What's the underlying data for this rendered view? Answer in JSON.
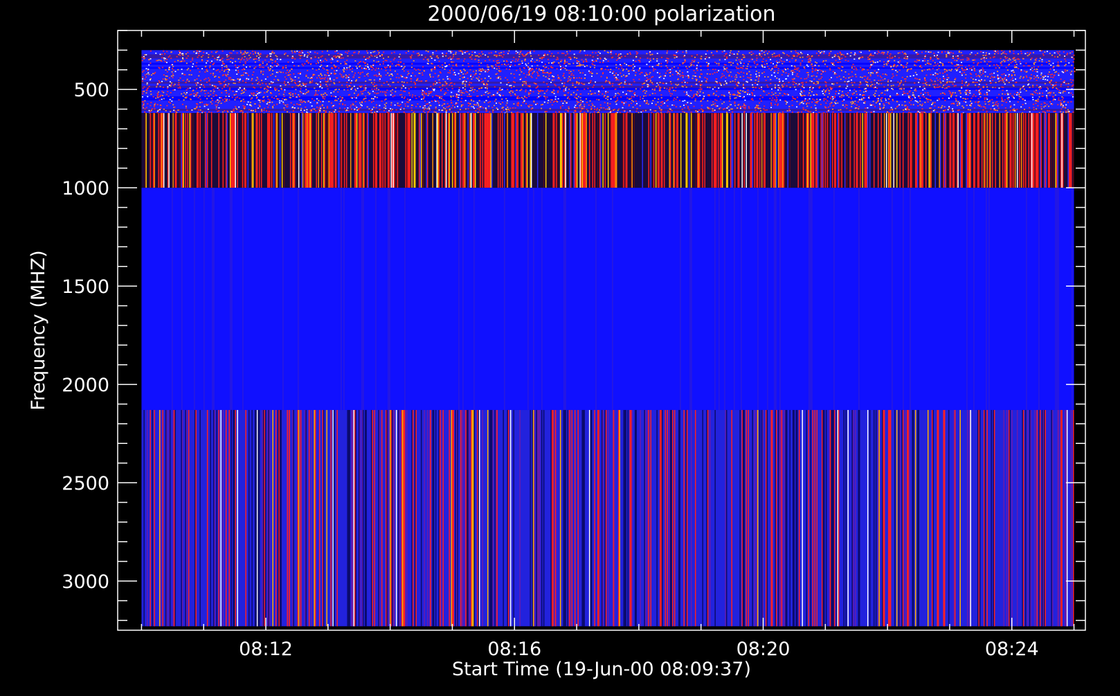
{
  "chart_data": {
    "type": "heatmap",
    "title": "2000/06/19 08:10:00 polarization",
    "xlabel": "Start Time (19-Jun-00 08:09:37)",
    "ylabel": "Frequency (MHZ)",
    "x_axis": {
      "unit": "time",
      "range": [
        "08:09:37",
        "08:25:11"
      ],
      "data_range": [
        "08:10:00",
        "08:25:00"
      ],
      "tick_labels": [
        "08:12",
        "08:16",
        "08:20",
        "08:24"
      ],
      "tick_values": [
        "08:12:00",
        "08:16:00",
        "08:20:00",
        "08:24:00"
      ],
      "minor_tick_interval_min": 1
    },
    "y_axis": {
      "unit": "MHz",
      "range": [
        200,
        3250
      ],
      "reversed": true,
      "data_range": [
        300,
        3230
      ],
      "tick_labels": [
        "500",
        "1000",
        "1500",
        "2000",
        "2500",
        "3000"
      ],
      "tick_values": [
        500,
        1000,
        1500,
        2000,
        2500,
        3000
      ],
      "minor_tick_interval": 100
    },
    "bands": [
      {
        "freq_range": [
          300,
          620
        ],
        "pattern": "noisy horizontal speckle",
        "dominant": "#2020ff",
        "accents": [
          "#ff2a2a",
          "#ff9a2a",
          "#ffffff"
        ]
      },
      {
        "freq_range": [
          620,
          1000
        ],
        "pattern": "vertical striations",
        "dominant": "#1a0b3a",
        "accents": [
          "#ff2020",
          "#ffcc00",
          "#ff8c00",
          "#ffffff",
          "#2a2aff"
        ]
      },
      {
        "freq_range": [
          1000,
          2130
        ],
        "pattern": "mostly uniform",
        "dominant": "#1010ff",
        "accents": [
          "#5a2aa0"
        ]
      },
      {
        "freq_range": [
          2130,
          3230
        ],
        "pattern": "vertical striations",
        "dominant": "#2222dd",
        "accents": [
          "#ff2020",
          "#ffb000",
          "#ffffff",
          "#0a0a6a"
        ]
      }
    ],
    "colors": {
      "background": "#000000",
      "axes": "#ffffff"
    },
    "grid": false,
    "legend": "none"
  }
}
